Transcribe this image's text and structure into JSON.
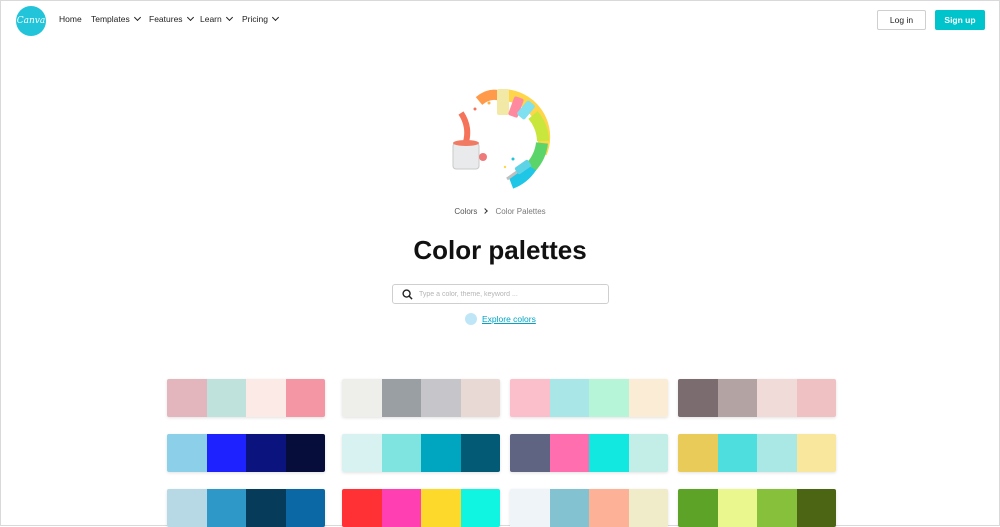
{
  "nav": {
    "logo_text": "Canva",
    "items": [
      {
        "label": "Home",
        "dropdown": false
      },
      {
        "label": "Templates",
        "dropdown": true
      },
      {
        "label": "Features",
        "dropdown": true
      },
      {
        "label": "Learn",
        "dropdown": true
      },
      {
        "label": "Pricing",
        "dropdown": true
      }
    ],
    "login_label": "Log in",
    "signup_label": "Sign up"
  },
  "breadcrumb": {
    "parent": "Colors",
    "current": "Color Palettes"
  },
  "page_title": "Color palettes",
  "search": {
    "placeholder": "Type a color, theme, keyword ..."
  },
  "explore_label": "Explore colors",
  "colors": {
    "accent": "#00c4cc",
    "link": "#00a4c4"
  },
  "palettes": [
    [
      "#e3b5bc",
      "#bfe3dc",
      "#fbeae6",
      "#f496a3"
    ],
    [
      "#eeeeea",
      "#9a9fa3",
      "#c6c5ca",
      "#e9d9d5"
    ],
    [
      "#fbbfcc",
      "#a8e6e8",
      "#b7f5d8",
      "#fbecd5"
    ],
    [
      "#7a6c6f",
      "#b3a3a3",
      "#f1dbd9",
      "#efc1c3"
    ],
    [
      "#8bcfe8",
      "#1e22ff",
      "#0b137f",
      "#060d3b"
    ],
    [
      "#d8f2f2",
      "#7fe3e0",
      "#00a5bf",
      "#035a75"
    ],
    [
      "#5e6482",
      "#ff6fb0",
      "#12e8e0",
      "#c3eee7"
    ],
    [
      "#e8cb58",
      "#4edede",
      "#aae8e6",
      "#f8e79c"
    ],
    [
      "#b6d9e5",
      "#2e98c8",
      "#063b59",
      "#0b68a4"
    ],
    [
      "#ff3135",
      "#ff3fb2",
      "#fcd92b",
      "#10f4e2"
    ],
    [
      "#eef4f8",
      "#83c3d1",
      "#fdb197",
      "#f0ebc9"
    ],
    [
      "#5da327",
      "#eaf78e",
      "#87c03b",
      "#4c6515"
    ]
  ]
}
